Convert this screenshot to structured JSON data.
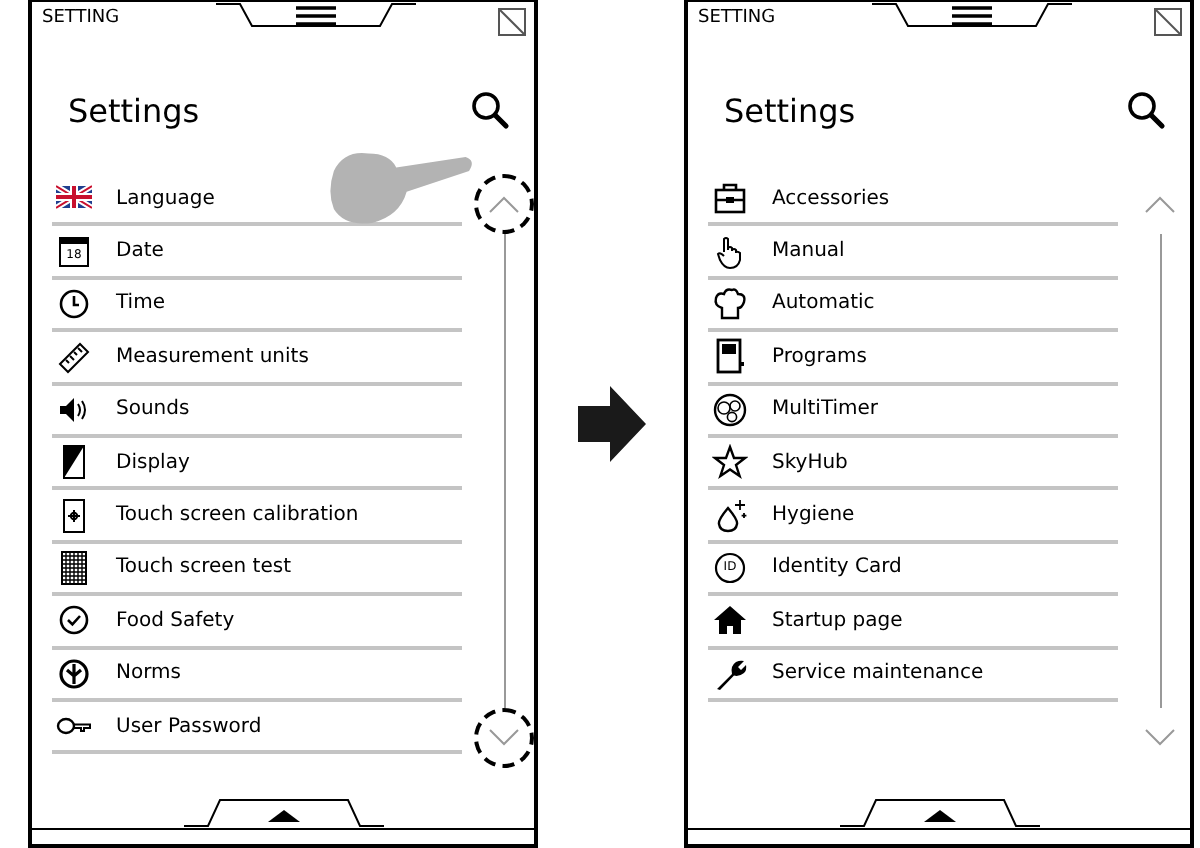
{
  "screens": [
    {
      "header_label": "SETTING",
      "title": "Settings",
      "touch_hint": true,
      "scroll_highlighted": true,
      "items": [
        {
          "label": "Language",
          "kind": "flag"
        },
        {
          "label": "Date",
          "kind": "calendar",
          "icon_text": "18"
        },
        {
          "label": "Time",
          "kind": "clock"
        },
        {
          "label": "Measurement units",
          "kind": "ruler"
        },
        {
          "label": "Sounds",
          "kind": "speaker"
        },
        {
          "label": "Display",
          "kind": "display"
        },
        {
          "label": "Touch screen calibration",
          "kind": "crosshair"
        },
        {
          "label": "Touch screen test",
          "kind": "grid"
        },
        {
          "label": "Food Safety",
          "kind": "check"
        },
        {
          "label": "Norms",
          "kind": "emblem"
        },
        {
          "label": "User Password",
          "kind": "key"
        }
      ]
    },
    {
      "header_label": "SETTING",
      "title": "Settings",
      "touch_hint": false,
      "scroll_highlighted": false,
      "items": [
        {
          "label": "Accessories",
          "kind": "case"
        },
        {
          "label": "Manual",
          "kind": "hand"
        },
        {
          "label": "Automatic",
          "kind": "hat"
        },
        {
          "label": "Programs",
          "kind": "panel"
        },
        {
          "label": "MultiTimer",
          "kind": "timers"
        },
        {
          "label": "SkyHub",
          "kind": "star"
        },
        {
          "label": "Hygiene",
          "kind": "drop"
        },
        {
          "label": "Identity Card",
          "kind": "id",
          "icon_text": "ID"
        },
        {
          "label": "Startup page",
          "kind": "house"
        },
        {
          "label": "Service maintenance",
          "kind": "wrench"
        }
      ]
    }
  ]
}
